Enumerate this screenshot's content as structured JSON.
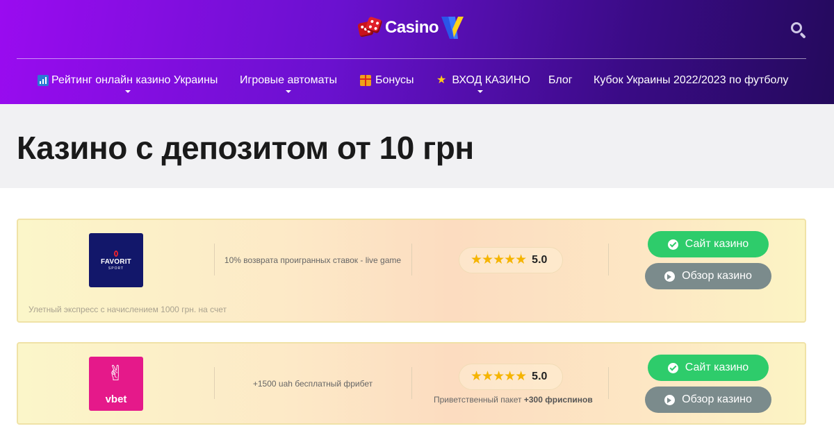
{
  "header": {
    "logo_text": "Casino",
    "nav": [
      {
        "label": "Рейтинг онлайн казино Украины",
        "has_dropdown": true,
        "icon": "chart-icon"
      },
      {
        "label": "Игровые автоматы",
        "has_dropdown": true
      },
      {
        "label": "Бонусы",
        "has_dropdown": false,
        "icon": "gift-icon"
      },
      {
        "label": "ВХОД КАЗИНО",
        "has_dropdown": true,
        "icon": "star-icon"
      },
      {
        "label": "Блог",
        "has_dropdown": false
      },
      {
        "label": "Кубок Украины 2022/2023 по футболу",
        "has_dropdown": false
      }
    ]
  },
  "page": {
    "title": "Казино с депозитом от 10 грн"
  },
  "casinos": [
    {
      "brand": "FAVORIT",
      "brand_sub": "SPORT",
      "bonus": "10% возврата проигранных ставок - live game",
      "stars": "★★★★★",
      "rating": "5.0",
      "site_button": "Сайт казино",
      "review_button": "Обзор казино",
      "note": "Улетный экспресс с начислением 1000 грн. на счет"
    },
    {
      "brand": "vbet",
      "bonus": "+1500 uah бесплатный фрибет",
      "stars": "★★★★★",
      "rating": "5.0",
      "promo_prefix": "Приветственный пакет ",
      "promo_bold": "+300 фриспинов",
      "site_button": "Сайт казино",
      "review_button": "Обзор казино"
    }
  ],
  "colors": {
    "header_start": "#9a0bf0",
    "header_end": "#240a5c",
    "site_button": "#2ecc6b",
    "review_button": "#7b8b8c",
    "star": "#f5b400"
  }
}
